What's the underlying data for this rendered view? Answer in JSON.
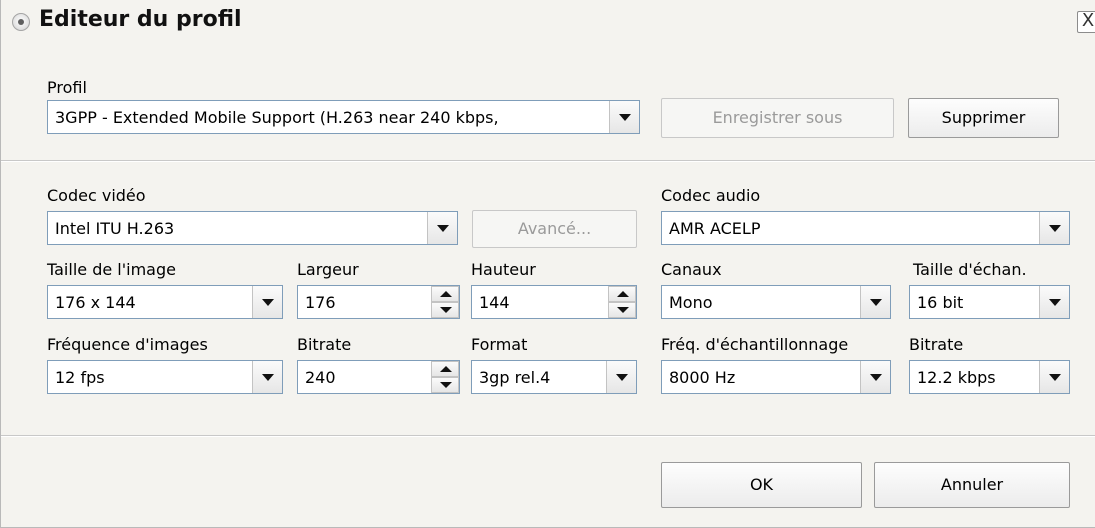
{
  "window": {
    "title": "Editeur du profil",
    "close_glyph": "X"
  },
  "profile": {
    "label": "Profil",
    "value": "3GPP - Extended Mobile Support (H.263 near 240 kbps,",
    "save_as_label": "Enregistrer sous",
    "delete_label": "Supprimer"
  },
  "video": {
    "codec_label": "Codec vidéo",
    "codec_value": "Intel ITU H.263",
    "advanced_label": "Avancé...",
    "image_size_label": "Taille de l'image",
    "image_size_value": "176 x 144",
    "width_label": "Largeur",
    "width_value": "176",
    "height_label": "Hauteur",
    "height_value": "144",
    "frame_rate_label": "Fréquence d'images",
    "frame_rate_value": "12 fps",
    "bitrate_label": "Bitrate",
    "bitrate_value": "240",
    "format_label": "Format",
    "format_value": "3gp rel.4"
  },
  "audio": {
    "codec_label": "Codec audio",
    "codec_value": "AMR ACELP",
    "channels_label": "Canaux",
    "channels_value": "Mono",
    "sample_size_label": "Taille d'échan.",
    "sample_size_value": "16 bit",
    "sample_rate_label": "Fréq. d'échantillonnage",
    "sample_rate_value": "8000 Hz",
    "bitrate_label": "Bitrate",
    "bitrate_value": "12.2 kbps"
  },
  "footer": {
    "ok_label": "OK",
    "cancel_label": "Annuler"
  }
}
